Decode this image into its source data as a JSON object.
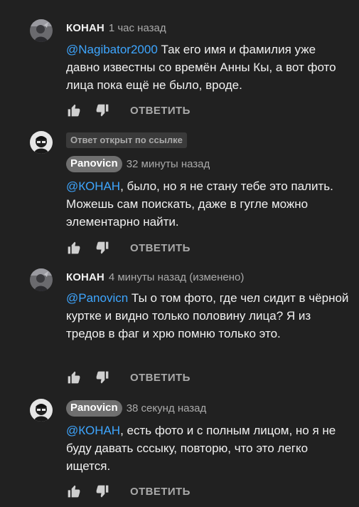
{
  "comments": [
    {
      "author": "КОНАН",
      "time": "1 час назад",
      "mention": "@Nagibator2000",
      "text": " Так его имя и фамилия уже давно известны со времён Анны Кы, а вот фото лица пока ещё не было, вроде.",
      "reply_label": "ОТВЕТИТЬ"
    },
    {
      "badge": "Ответ открыт по ссылке",
      "author": "Panovicn",
      "time": "32 минуты назад",
      "mention": "@КОНАН",
      "text": ", было, но я не стану тебе это палить. Можешь сам поискать, даже в гугле можно элементарно найти.",
      "reply_label": "ОТВЕТИТЬ"
    },
    {
      "author": "КОНАН",
      "time": "4 минуты назад (изменено)",
      "mention": "@Panovicn",
      "text": " Ты о том фото, где чел сидит в чёрной куртке и видно только половину лица? Я из тредов в фаг и хрю помню только это.",
      "reply_label": "ОТВЕТИТЬ"
    },
    {
      "author": "Panovicn",
      "time": "38 секунд назад",
      "mention": "@КОНАН",
      "text": ", есть фото и с полным лицом, но я не буду давать сссыку, повторю, что это легко ищется.",
      "reply_label": "ОТВЕТИТЬ"
    }
  ],
  "colors": {
    "background": "#212121",
    "mention": "#3ea6ff",
    "secondary_text": "#aaaaaa",
    "author_chip": "#6f6f6f"
  },
  "icons": [
    "thumb-up-icon",
    "thumb-down-icon"
  ]
}
